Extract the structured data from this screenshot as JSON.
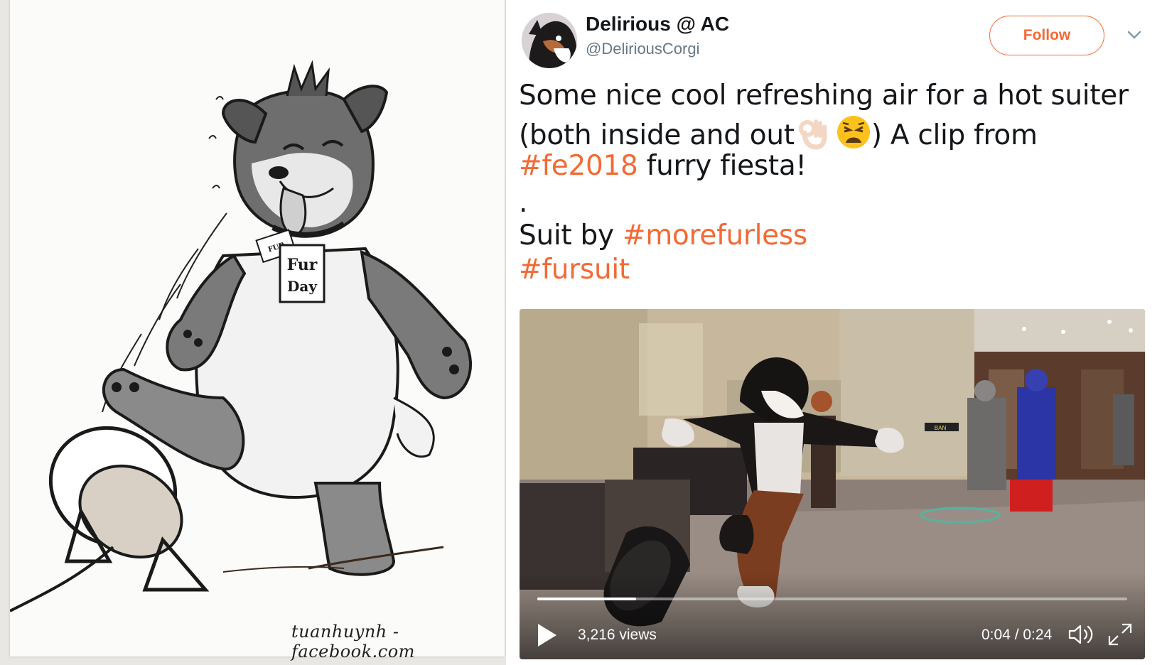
{
  "artwork": {
    "signature": "tuanhuynh - facebook.com",
    "tag_small": "FUR",
    "tag_main_line1": "Fur",
    "tag_main_line2": "Day"
  },
  "tweet": {
    "display_name": "Delirious @ AC",
    "handle": "@DeliriousCorgi",
    "follow_label": "Follow",
    "text_line1": "Some nice cool refreshing air for a hot suiter",
    "text_line2a": "(both inside and out",
    "text_line2b": ") A clip from",
    "hashtag_fe2018": "#fe2018",
    "text_line3b": " furry fiesta!",
    "dot_line": ".",
    "text_suit_by": "Suit by ",
    "hashtag_morefurless": "#morefurless",
    "hashtag_fursuit": "#fursuit",
    "emoji": [
      "ok-hand-icon",
      "weary-face-icon"
    ]
  },
  "video": {
    "views": "3,216 views",
    "time": "0:04 / 0:24",
    "progress": 0.167,
    "sign_text": "BAN"
  },
  "colors": {
    "accent": "#f26a35",
    "name": "#14171a",
    "handle": "#657786"
  }
}
